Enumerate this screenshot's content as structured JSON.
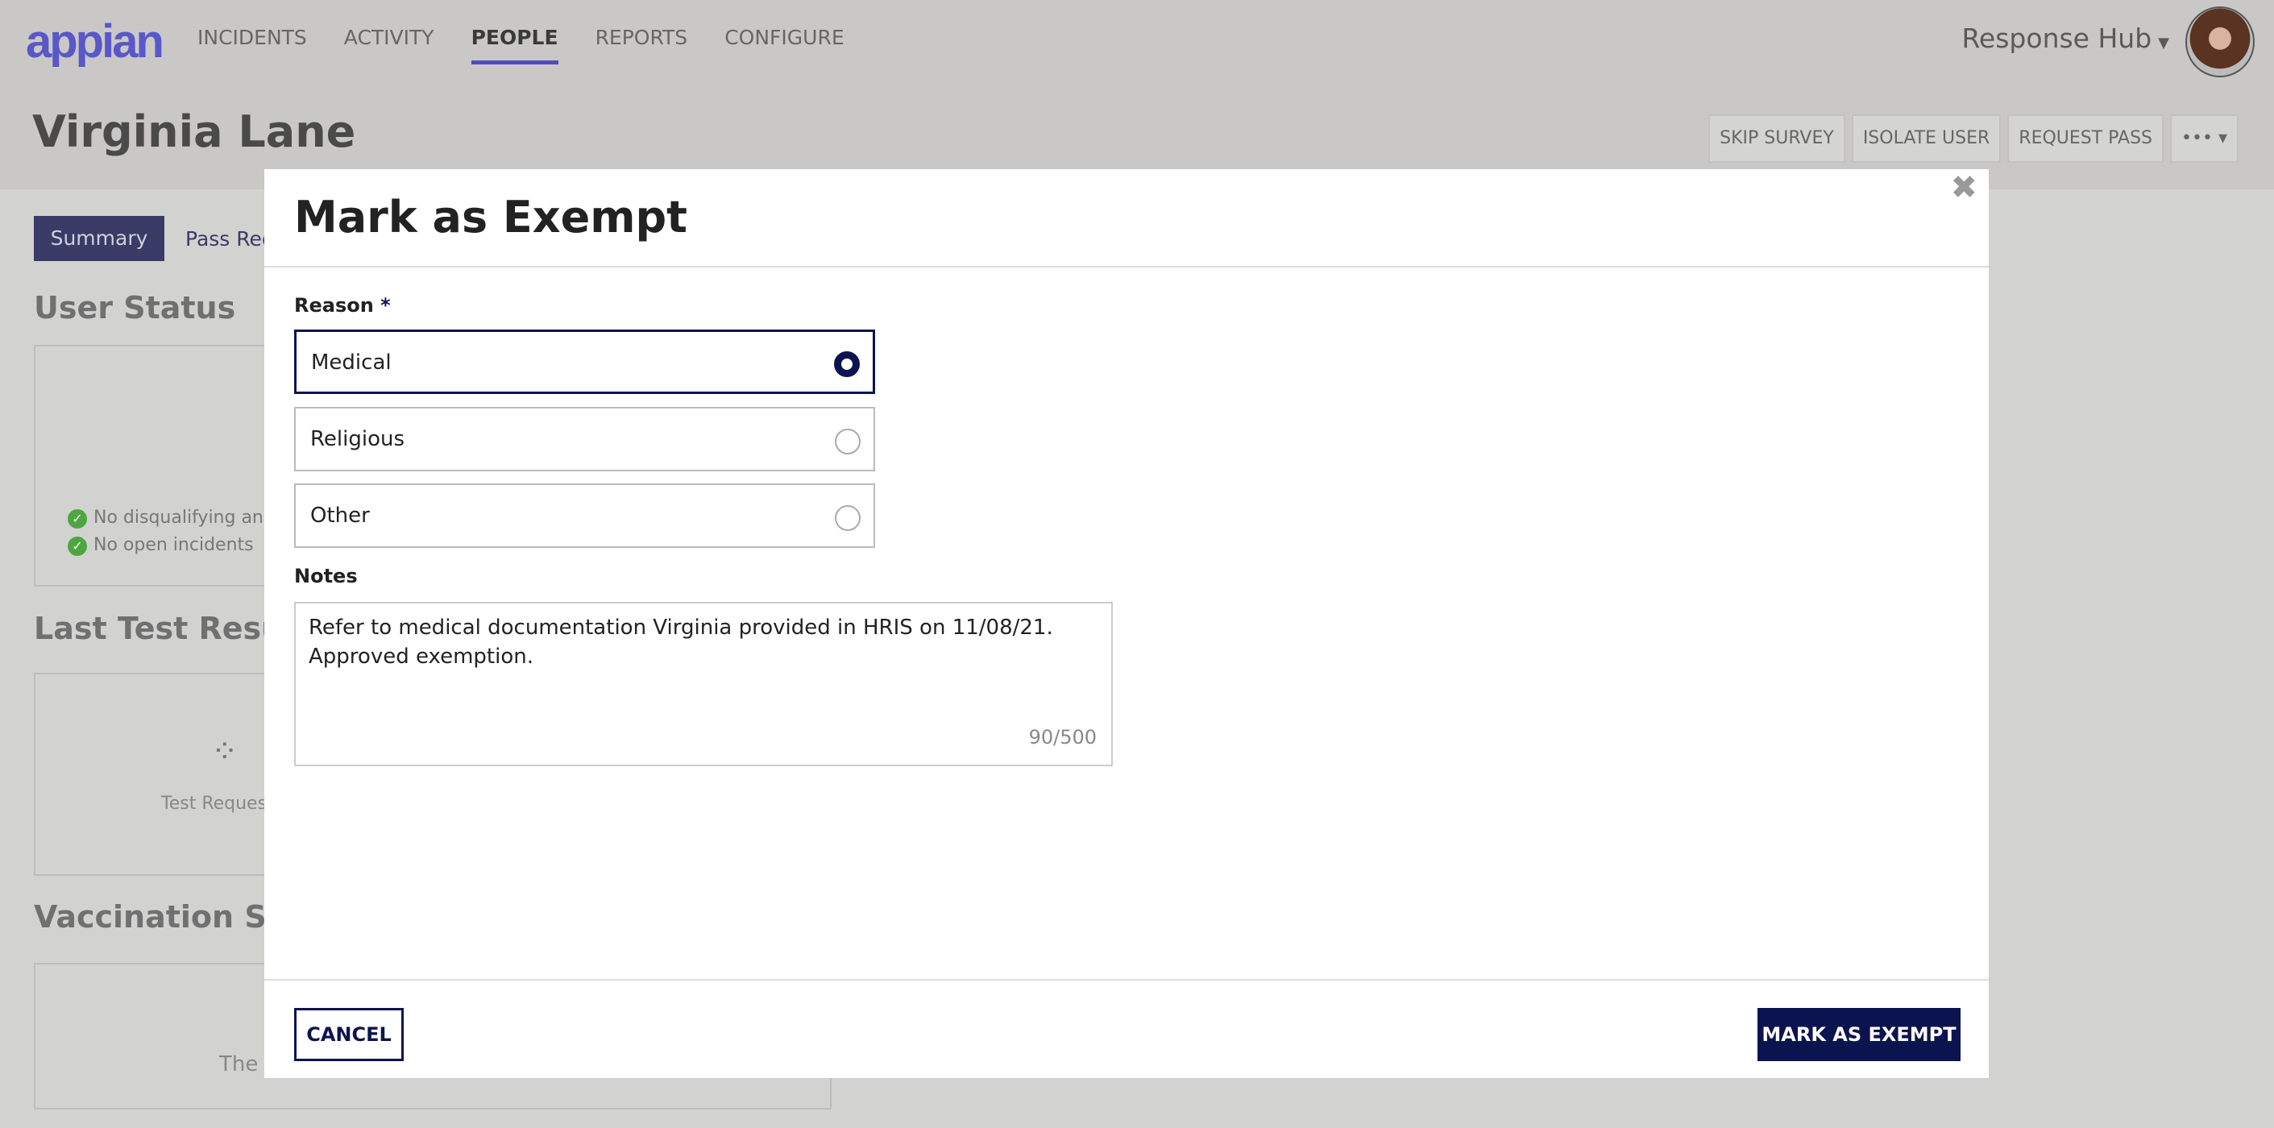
{
  "header": {
    "logo": "appian",
    "nav": [
      "INCIDENTS",
      "ACTIVITY",
      "PEOPLE",
      "REPORTS",
      "CONFIGURE"
    ],
    "active_nav": "PEOPLE",
    "site": "Response Hub"
  },
  "page": {
    "title": "Virginia Lane",
    "actions": [
      "SKIP SURVEY",
      "ISOLATE USER",
      "REQUEST PASS"
    ],
    "tabs": [
      "Summary",
      "Pass Rec"
    ],
    "sections": {
      "user_status": "User Status",
      "checks": [
        "No disqualifying answ",
        "No open incidents"
      ],
      "last_test": "Last Test Resul",
      "test_text": "Test Request",
      "vaccination": "Vaccination Sta",
      "vacc_text": "The u"
    }
  },
  "modal": {
    "title": "Mark as Exempt",
    "reason_label": "Reason",
    "required_mark": "*",
    "options": [
      "Medical",
      "Religious",
      "Other"
    ],
    "selected": "Medical",
    "notes_label": "Notes",
    "notes_value": "Refer to medical documentation Virginia provided in HRIS on 11/08/21. Approved exemption.",
    "char_count": "90/500",
    "cancel": "CANCEL",
    "submit": "MARK AS EXEMPT"
  },
  "colors": {
    "primary": "#0c1450",
    "accent": "#4f4cc4",
    "success": "#4da63f"
  }
}
